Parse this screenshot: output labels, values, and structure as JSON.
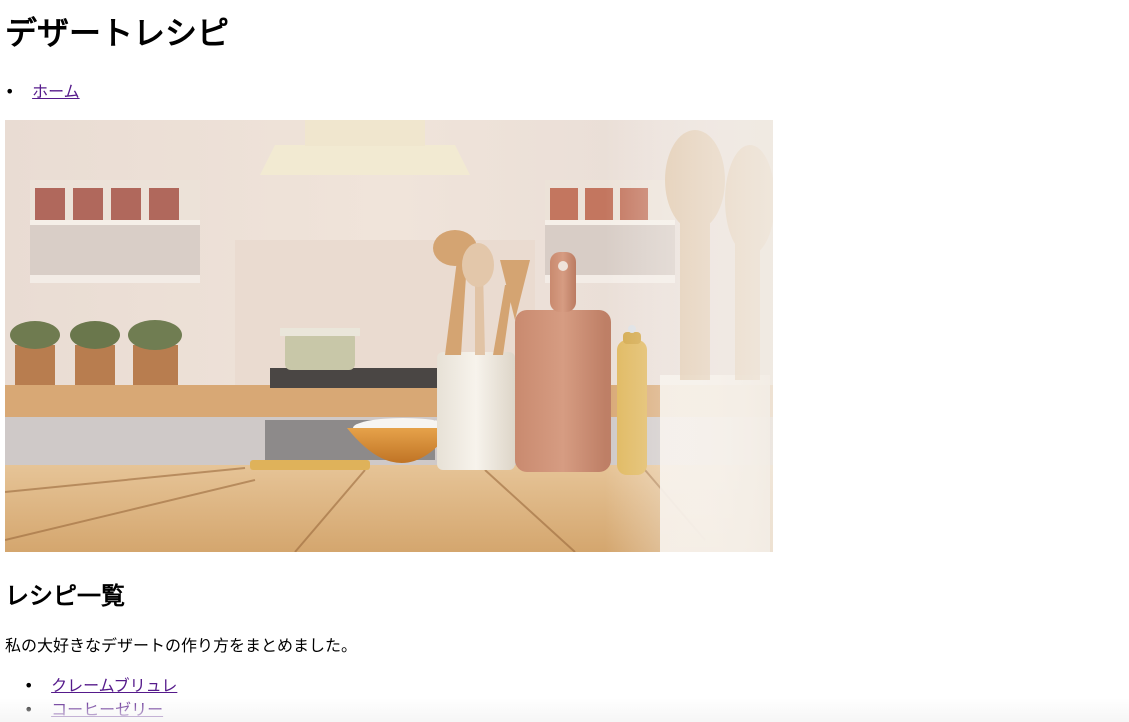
{
  "page": {
    "title": "デザートレシピ"
  },
  "nav": {
    "items": [
      {
        "label": "ホーム"
      }
    ]
  },
  "hero": {
    "image": "kitchen-counter-utensils-photo"
  },
  "section": {
    "heading": "レシピ一覧",
    "description": "私の大好きなデザートの作り方をまとめました。"
  },
  "recipes": {
    "items": [
      {
        "label": "クレームブリュレ"
      },
      {
        "label": "コーヒーゼリー"
      }
    ]
  }
}
